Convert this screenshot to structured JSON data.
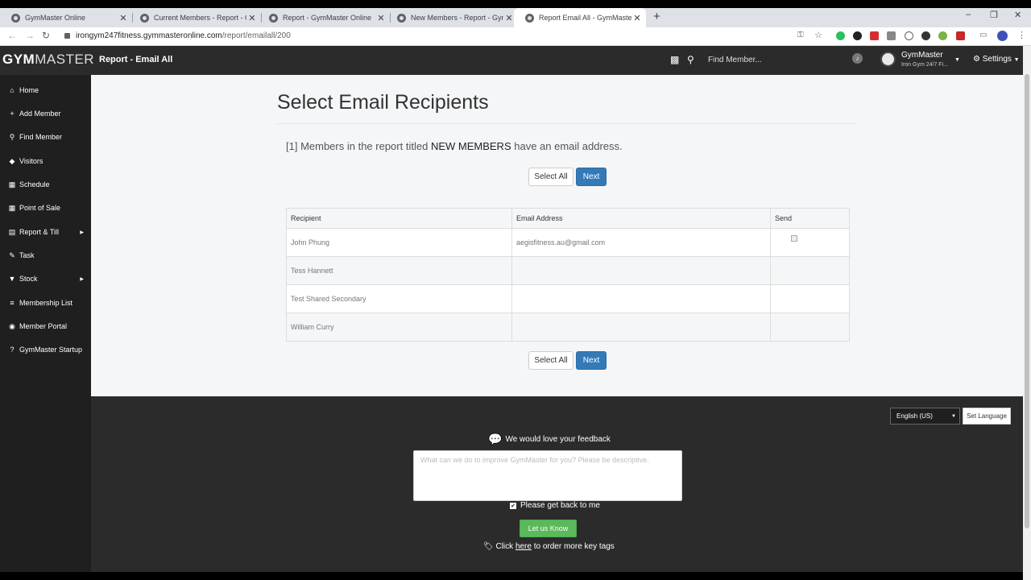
{
  "browser": {
    "tabs": [
      {
        "title": "GymMaster Online"
      },
      {
        "title": "Current Members - Report - Gym"
      },
      {
        "title": "Report - GymMaster Online"
      },
      {
        "title": "New Members - Report - GymMa"
      },
      {
        "title": "Report Email All - GymMaster On"
      }
    ],
    "new_tab": "+",
    "url_host": "irongym247fitness.gymmasteronline.com",
    "url_path": "/report/emailall/200"
  },
  "header": {
    "logo_bold": "GYM",
    "logo_thin": "MASTER",
    "page_title": "Report - Email All",
    "search_placeholder": "Find Member...",
    "user_name": "GymMaster",
    "user_gym": "Iron Gym 24/7 Fi...",
    "settings_label": "Settings"
  },
  "sidebar": {
    "items": [
      {
        "label": "Home",
        "icon": "home-icon",
        "glyph": "⌂"
      },
      {
        "label": "Add Member",
        "icon": "plus-icon",
        "glyph": "+"
      },
      {
        "label": "Find Member",
        "icon": "search-icon",
        "glyph": "⚲"
      },
      {
        "label": "Visitors",
        "icon": "tag-icon",
        "glyph": "◆"
      },
      {
        "label": "Schedule",
        "icon": "calendar-icon",
        "glyph": "▦"
      },
      {
        "label": "Point of Sale",
        "icon": "grid-icon",
        "glyph": "▦"
      },
      {
        "label": "Report & Till",
        "icon": "print-icon",
        "glyph": "▤"
      },
      {
        "label": "Task",
        "icon": "edit-icon",
        "glyph": "✎"
      },
      {
        "label": "Stock",
        "icon": "tshirt-icon",
        "glyph": "▼"
      },
      {
        "label": "Membership List",
        "icon": "list-icon",
        "glyph": "≡"
      },
      {
        "label": "Member Portal",
        "icon": "globe-icon",
        "glyph": "◉"
      },
      {
        "label": "GymMaster Startup",
        "icon": "question-icon",
        "glyph": "?"
      }
    ]
  },
  "main": {
    "title": "Select Email Recipients",
    "info_prefix": "[1] Members in the report titled",
    "info_report": "NEW MEMBERS",
    "info_suffix": "have an email address.",
    "select_all_label": "Select All",
    "next_label": "Next",
    "table": {
      "headers": [
        "Recipient",
        "Email Address",
        "Send"
      ],
      "rows": [
        {
          "recipient": "John Phung",
          "email": "aegisfitness.au@gmail.com",
          "send": true
        },
        {
          "recipient": "Tess Hannett",
          "email": "",
          "send": false
        },
        {
          "recipient": "Test Shared Secondary",
          "email": "",
          "send": false
        },
        {
          "recipient": "William Curry",
          "email": "",
          "send": false
        }
      ]
    }
  },
  "footer": {
    "language_value": "English (US)",
    "set_language_label": "Set Language",
    "feedback_title": "We would love your feedback",
    "feedback_placeholder": "What can we do to improve GymMaster for you? Please be descriptive.",
    "get_back_label": "Please get back to me",
    "submit_label": "Let us Know",
    "keytags_prefix": "Click",
    "keytags_link": "here",
    "keytags_suffix": "to order more key tags"
  }
}
